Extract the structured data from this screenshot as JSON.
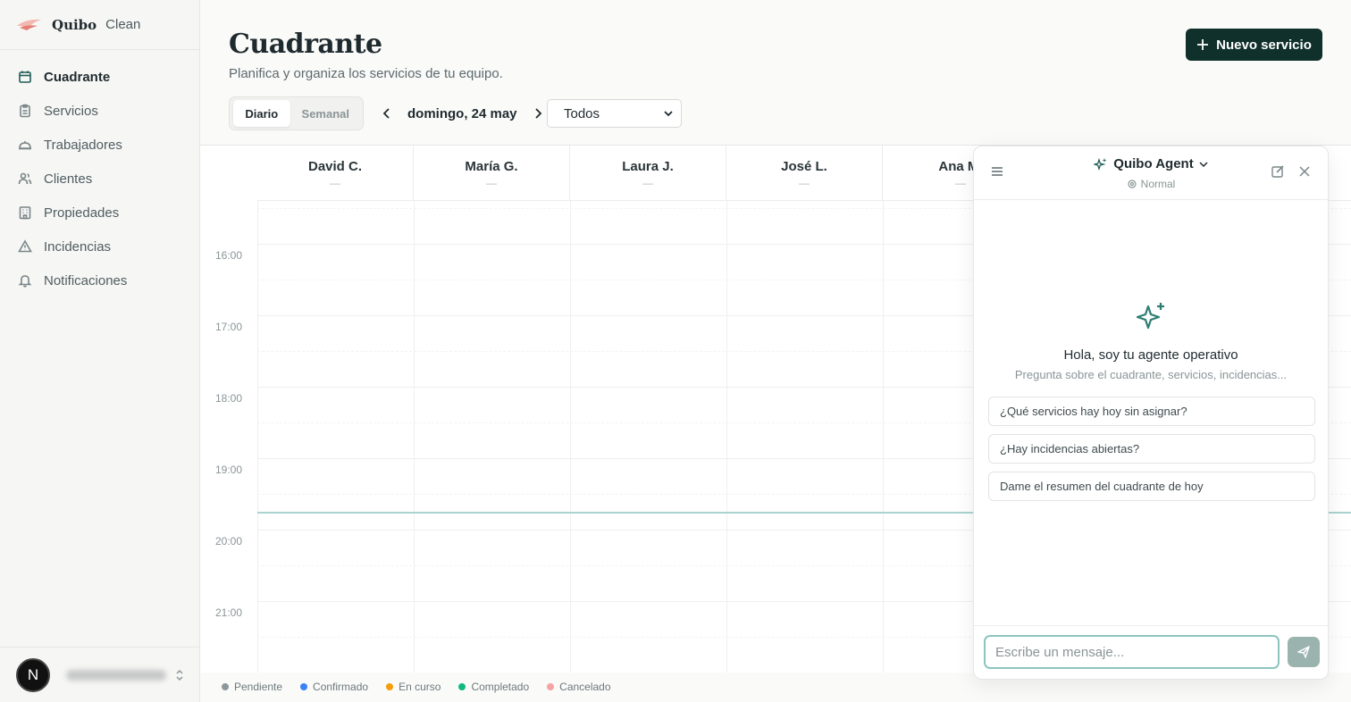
{
  "brand": {
    "name": "Quibo",
    "suffix": "Clean"
  },
  "sidebar": {
    "items": [
      {
        "label": "Cuadrante",
        "icon": "calendar-icon",
        "active": true
      },
      {
        "label": "Servicios",
        "icon": "clipboard-icon"
      },
      {
        "label": "Trabajadores",
        "icon": "worker-icon"
      },
      {
        "label": "Clientes",
        "icon": "users-icon"
      },
      {
        "label": "Propiedades",
        "icon": "building-icon"
      },
      {
        "label": "Incidencias",
        "icon": "warning-icon"
      },
      {
        "label": "Notificaciones",
        "icon": "bell-icon"
      }
    ],
    "user": {
      "initial": "N"
    }
  },
  "header": {
    "title": "Cuadrante",
    "subtitle": "Planifica y organiza los servicios de tu equipo.",
    "new_button": "Nuevo servicio"
  },
  "toolbar": {
    "view_daily": "Diario",
    "view_weekly": "Semanal",
    "date": "domingo, 24 may",
    "filter": "Todos"
  },
  "calendar": {
    "workers": [
      {
        "name": "David C.",
        "count": "—"
      },
      {
        "name": "María G.",
        "count": "—"
      },
      {
        "name": "Laura J.",
        "count": "—"
      },
      {
        "name": "José L.",
        "count": "—"
      },
      {
        "name": "Ana M.",
        "count": "—"
      }
    ],
    "hours": [
      "16:00",
      "17:00",
      "18:00",
      "19:00",
      "20:00",
      "21:00"
    ]
  },
  "legend": [
    {
      "label": "Pendiente",
      "color": "#8e979b"
    },
    {
      "label": "Confirmado",
      "color": "#3b82f6"
    },
    {
      "label": "En curso",
      "color": "#f59e0b"
    },
    {
      "label": "Completado",
      "color": "#10b981"
    },
    {
      "label": "Cancelado",
      "color": "#f5a3a3"
    }
  ],
  "agent": {
    "title": "Quibo Agent",
    "mode": "Normal",
    "greeting": "Hola, soy tu agente operativo",
    "hint": "Pregunta sobre el cuadrante, servicios, incidencias...",
    "suggestions": [
      "¿Qué servicios hay hoy sin asignar?",
      "¿Hay incidencias abiertas?",
      "Dame el resumen del cuadrante de hoy"
    ],
    "input_placeholder": "Escribe un mensaje..."
  },
  "colors": {
    "accent": "#10302b",
    "brand_green": "#1f5c55",
    "agent_border": "#8cc5c0"
  }
}
